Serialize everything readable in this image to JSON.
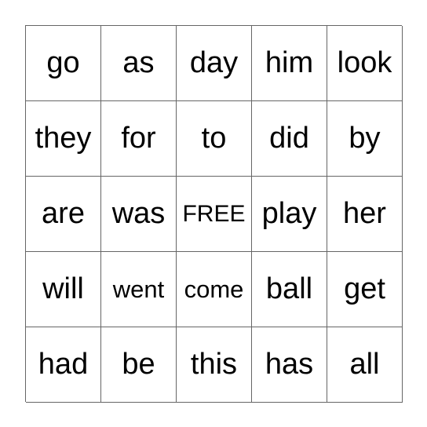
{
  "board": {
    "rows": [
      [
        "go",
        "as",
        "day",
        "him",
        "look"
      ],
      [
        "they",
        "for",
        "to",
        "did",
        "by"
      ],
      [
        "are",
        "was",
        "FREE",
        "play",
        "her"
      ],
      [
        "will",
        "went",
        "come",
        "ball",
        "get"
      ],
      [
        "had",
        "be",
        "this",
        "has",
        "all"
      ]
    ],
    "free_label": "FREE"
  }
}
